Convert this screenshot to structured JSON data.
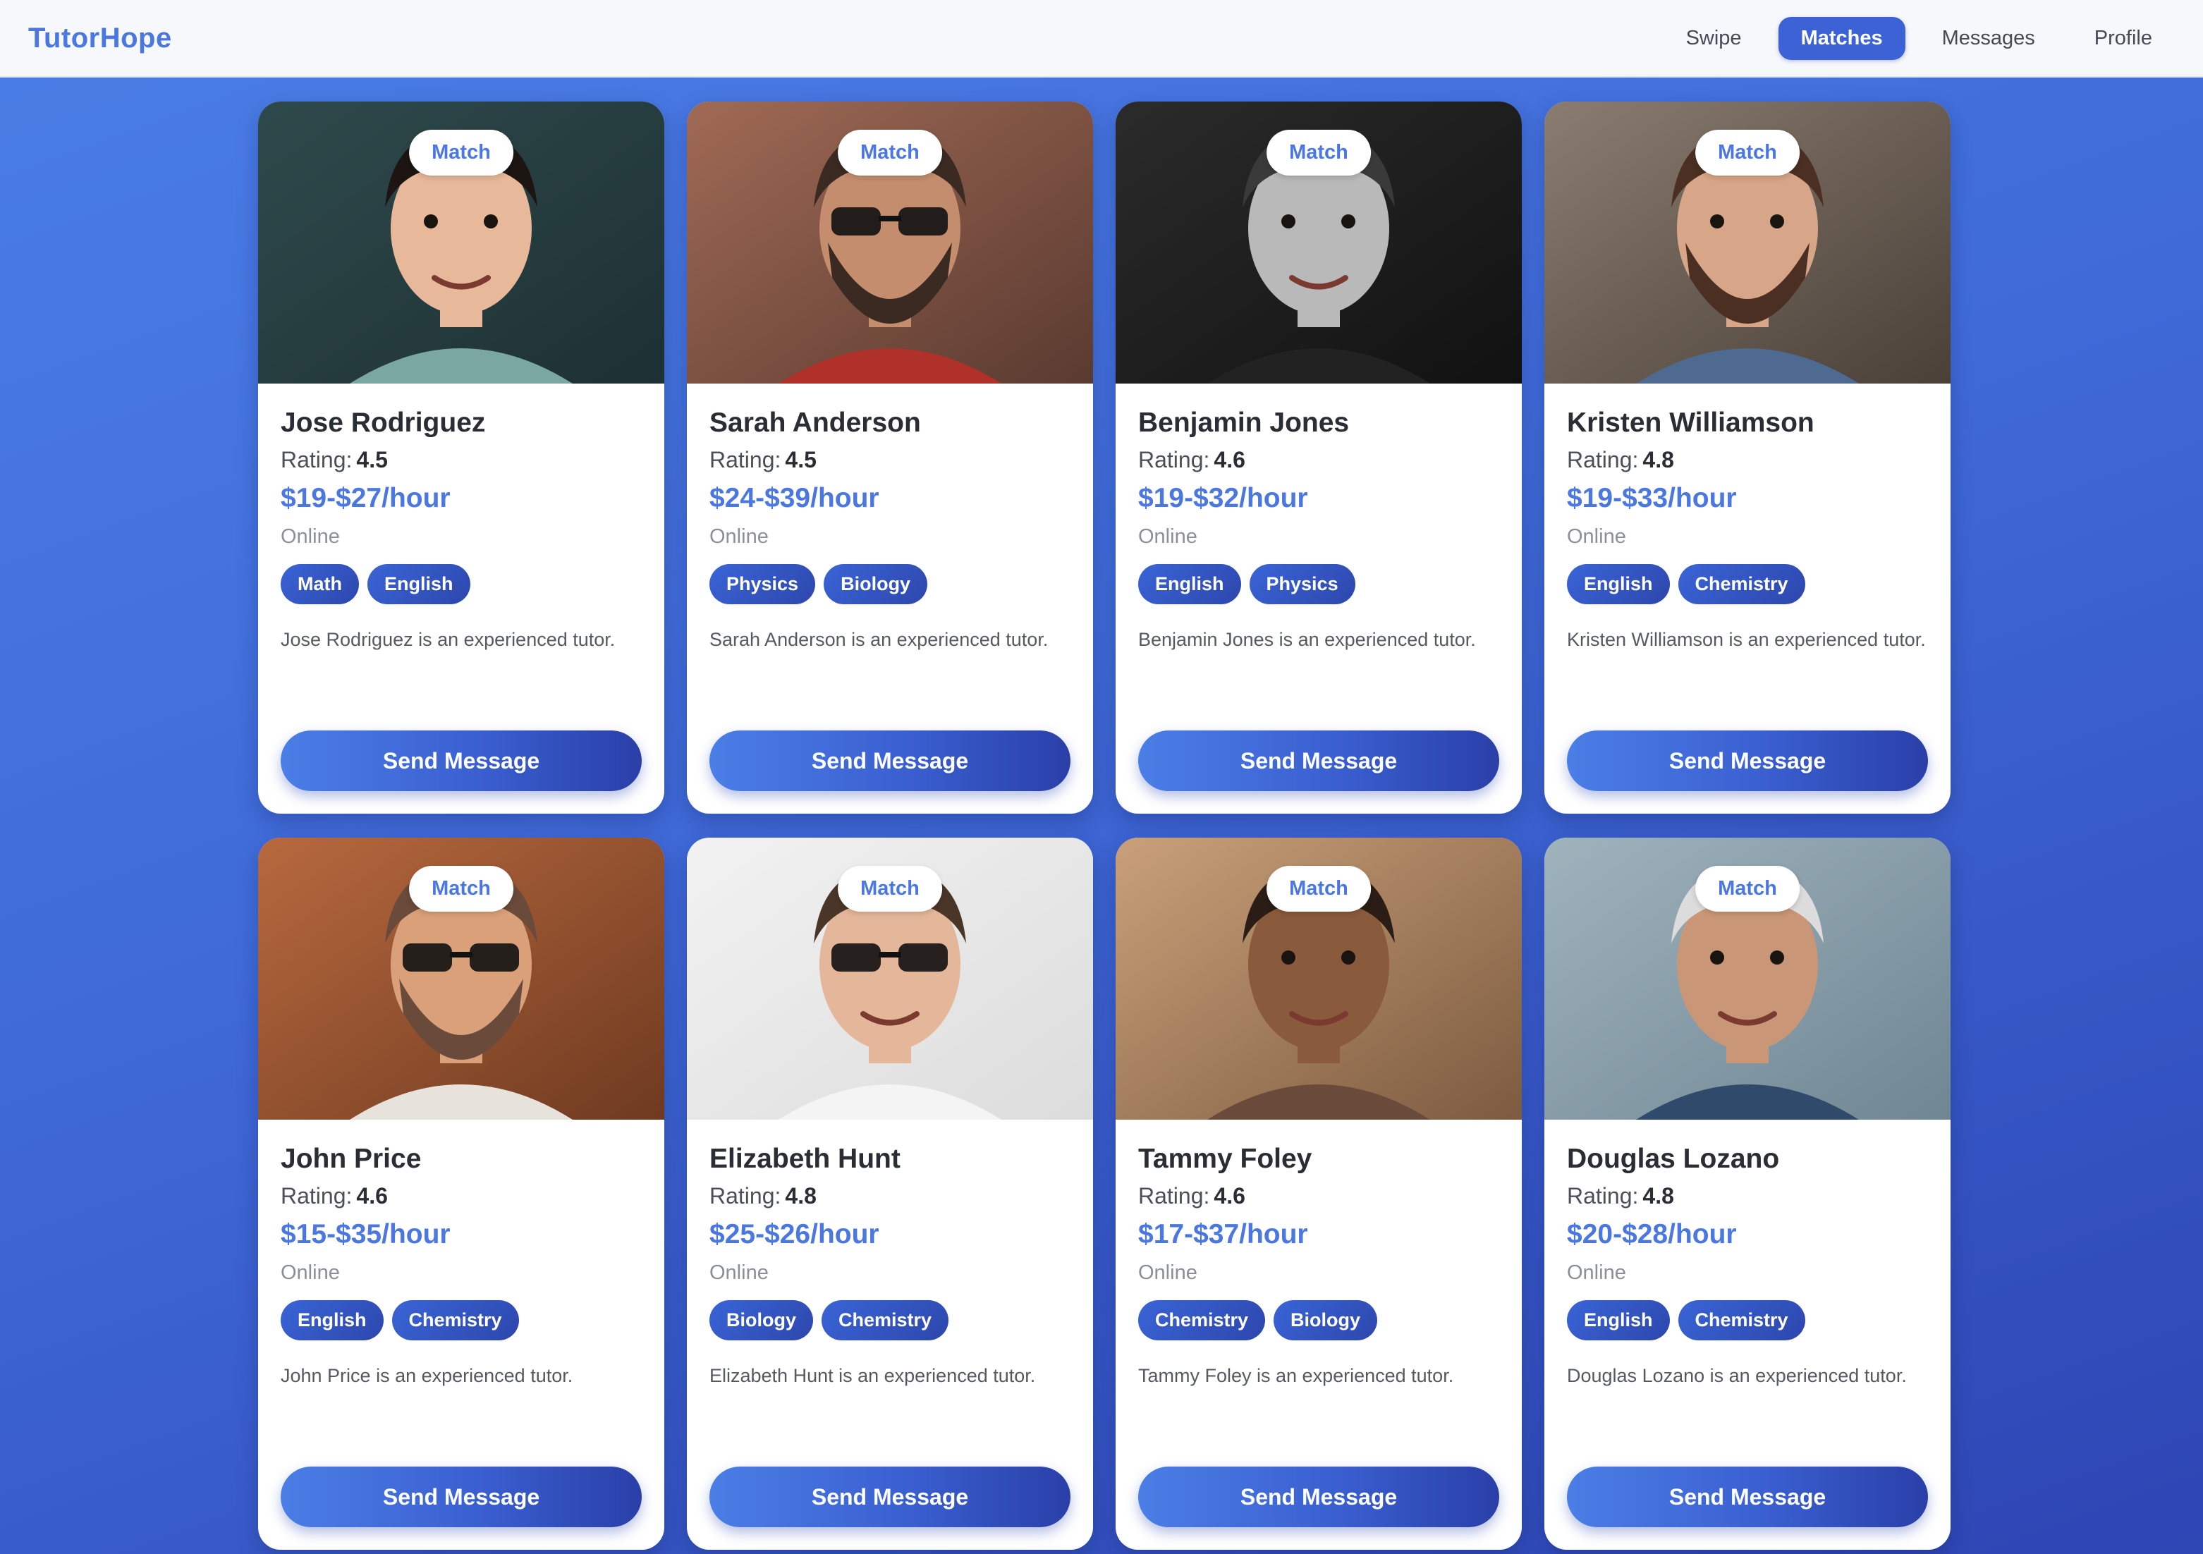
{
  "app": {
    "brand": "TutorHope"
  },
  "nav": {
    "items": [
      {
        "label": "Swipe",
        "active": false
      },
      {
        "label": "Matches",
        "active": true
      },
      {
        "label": "Messages",
        "active": false
      },
      {
        "label": "Profile",
        "active": false
      }
    ]
  },
  "labels": {
    "match_badge": "Match",
    "rating_prefix": "Rating:",
    "send_button": "Send Message"
  },
  "tutors": [
    {
      "name": "Jose Rodriguez",
      "rating": "4.5",
      "price": "$19-$27/hour",
      "status": "Online",
      "tags": [
        "Math",
        "English"
      ],
      "bio": "Jose Rodriguez is an experienced tutor.",
      "photo": "child-curly-hair"
    },
    {
      "name": "Sarah Anderson",
      "rating": "4.5",
      "price": "$24-$39/hour",
      "status": "Online",
      "tags": [
        "Physics",
        "Biology"
      ],
      "bio": "Sarah Anderson is an experienced tutor.",
      "photo": "bearded-man-sunglasses"
    },
    {
      "name": "Benjamin Jones",
      "rating": "4.6",
      "price": "$19-$32/hour",
      "status": "Online",
      "tags": [
        "English",
        "Physics"
      ],
      "bio": "Benjamin Jones is an experienced tutor.",
      "photo": "smiling-man-bw"
    },
    {
      "name": "Kristen Williamson",
      "rating": "4.8",
      "price": "$19-$33/hour",
      "status": "Online",
      "tags": [
        "English",
        "Chemistry"
      ],
      "bio": "Kristen Williamson is an experienced tutor.",
      "photo": "bearded-man"
    },
    {
      "name": "John Price",
      "rating": "4.6",
      "price": "$15-$35/hour",
      "status": "Online",
      "tags": [
        "English",
        "Chemistry"
      ],
      "bio": "John Price is an experienced tutor.",
      "photo": "man-cap-glasses"
    },
    {
      "name": "Elizabeth Hunt",
      "rating": "4.8",
      "price": "$25-$26/hour",
      "status": "Online",
      "tags": [
        "Biology",
        "Chemistry"
      ],
      "bio": "Elizabeth Hunt is an experienced tutor.",
      "photo": "long-hair-man-sunglasses"
    },
    {
      "name": "Tammy Foley",
      "rating": "4.6",
      "price": "$17-$37/hour",
      "status": "Online",
      "tags": [
        "Chemistry",
        "Biology"
      ],
      "bio": "Tammy Foley is an experienced tutor.",
      "photo": "smiling-woman-braids"
    },
    {
      "name": "Douglas Lozano",
      "rating": "4.8",
      "price": "$20-$28/hour",
      "status": "Online",
      "tags": [
        "English",
        "Chemistry"
      ],
      "bio": "Douglas Lozano is an experienced tutor.",
      "photo": "elderly-man"
    }
  ],
  "colors": {
    "accent": "#4a78e0",
    "nav_active": "#3d62d6",
    "tag": "#3a64d6",
    "background_top": "#4b7ee6",
    "background_bottom": "#2e45b4"
  }
}
